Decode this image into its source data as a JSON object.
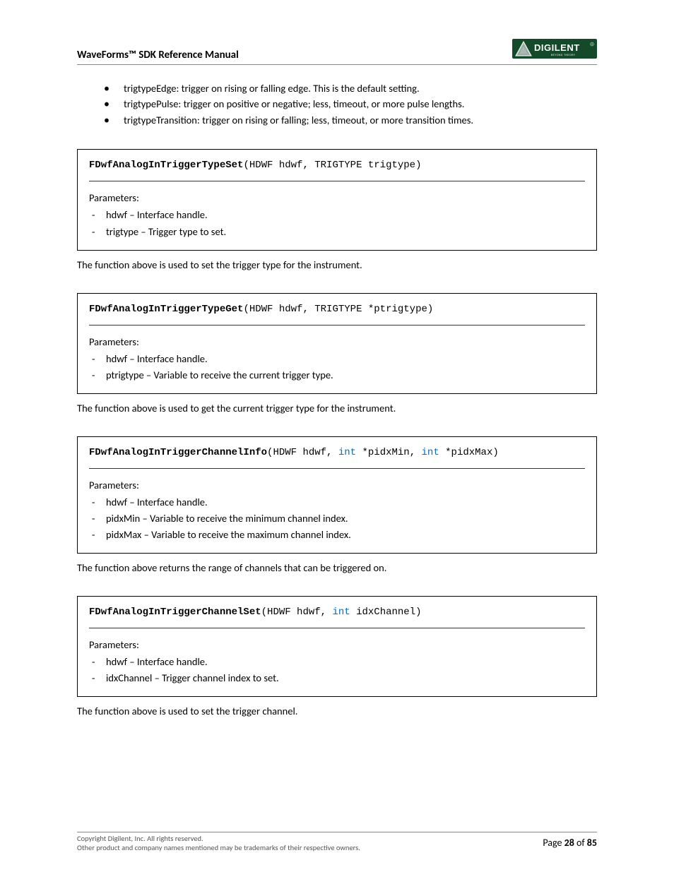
{
  "header": {
    "title": "WaveForms™ SDK Reference Manual"
  },
  "logo": {
    "brand": "DIGILENT",
    "tagline": "BEYOND THEORY"
  },
  "intro_bullets": [
    "trigtypeEdge: trigger on rising or falling edge.  This is the default setting.",
    "trigtypePulse: trigger on positive or negative; less, timeout, or more pulse lengths.",
    "trigtypeTransition: trigger on rising or falling; less, timeout, or more transition times."
  ],
  "functions": [
    {
      "name": "FDwfAnalogInTriggerTypeSet",
      "sig_parts": [
        {
          "t": "(HDWF hdwf, TRIGTYPE trigtype)"
        }
      ],
      "params_label": "Parameters:",
      "params": [
        "hdwf – Interface handle.",
        "trigtype – Trigger type to set."
      ],
      "description": "The function above is used to set the trigger type for the instrument."
    },
    {
      "name": "FDwfAnalogInTriggerTypeGet",
      "sig_parts": [
        {
          "t": "(HDWF hdwf, TRIGTYPE *ptrigtype)"
        }
      ],
      "params_label": "Parameters:",
      "params": [
        "hdwf – Interface handle.",
        "ptrigtype – Variable to receive the current trigger type."
      ],
      "description": "The function above is used to get the current trigger type for the instrument."
    },
    {
      "name": "FDwfAnalogInTriggerChannelInfo",
      "sig_parts": [
        {
          "t": "(HDWF hdwf, "
        },
        {
          "t": "int",
          "kw": true
        },
        {
          "t": " *pidxMin, "
        },
        {
          "t": "int",
          "kw": true
        },
        {
          "t": " *pidxMax)"
        }
      ],
      "params_label": "Parameters:",
      "params": [
        "hdwf – Interface handle.",
        "pidxMin – Variable to receive the minimum channel index.",
        "pidxMax – Variable to receive the maximum channel index."
      ],
      "description": "The function above returns the range of channels that can be triggered on."
    },
    {
      "name": "FDwfAnalogInTriggerChannelSet",
      "sig_parts": [
        {
          "t": "(HDWF hdwf, "
        },
        {
          "t": "int",
          "kw": true
        },
        {
          "t": " idxChannel)"
        }
      ],
      "params_label": "Parameters:",
      "params": [
        "hdwf – Interface handle.",
        "idxChannel – Trigger channel index to set."
      ],
      "description": "The function above is used to set the trigger channel."
    }
  ],
  "footer": {
    "copyright": "Copyright Digilent, Inc. All rights reserved.",
    "trademark": "Other product and company names mentioned may be trademarks of their respective owners.",
    "page_label": "Page ",
    "page_current": "28",
    "page_of": " of ",
    "page_total": "85"
  }
}
